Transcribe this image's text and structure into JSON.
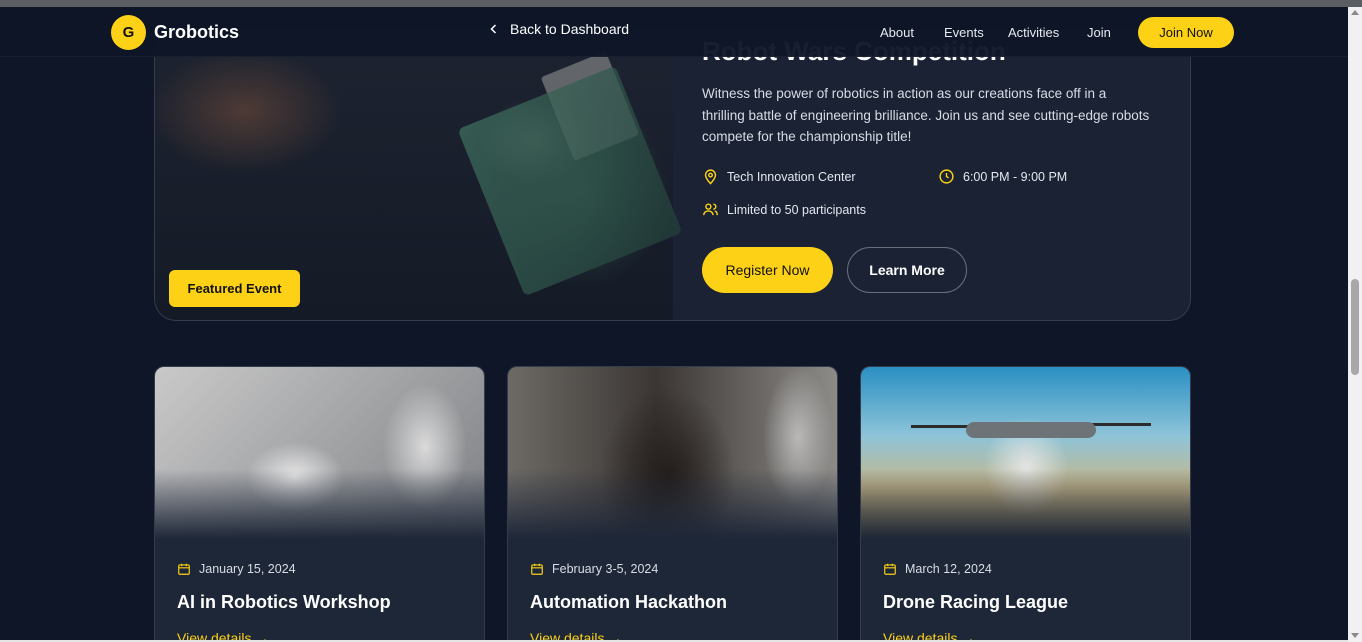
{
  "nav": {
    "logo_letter": "G",
    "brand": "Grobotics",
    "back_label": "Back to Dashboard",
    "links": [
      "About",
      "Events",
      "Activities",
      "Join"
    ],
    "cta": "Join Now"
  },
  "featured": {
    "title": "Robot Wars Competition",
    "description": "Witness the power of robotics in action as our creations face off in a thrilling battle of engineering brilliance. Join us and see cutting-edge robots compete for the championship title!",
    "location": "Tech Innovation Center",
    "time": "6:00 PM - 9:00 PM",
    "capacity": "Limited to 50 participants",
    "badge": "Featured Event",
    "register_label": "Register Now",
    "learn_label": "Learn More"
  },
  "events": [
    {
      "date": "January 15, 2024",
      "title": "AI in Robotics Workshop",
      "link": "View details →"
    },
    {
      "date": "February 3-5, 2024",
      "title": "Automation Hackathon",
      "link": "View details →"
    },
    {
      "date": "March 12, 2024",
      "title": "Drone Racing League",
      "link": "View details →"
    }
  ],
  "colors": {
    "accent": "#fcd116",
    "background": "#0e1628",
    "card": "#1e2738"
  },
  "icons": [
    "chevron-left-icon",
    "map-pin-icon",
    "clock-icon",
    "users-icon",
    "calendar-icon"
  ]
}
